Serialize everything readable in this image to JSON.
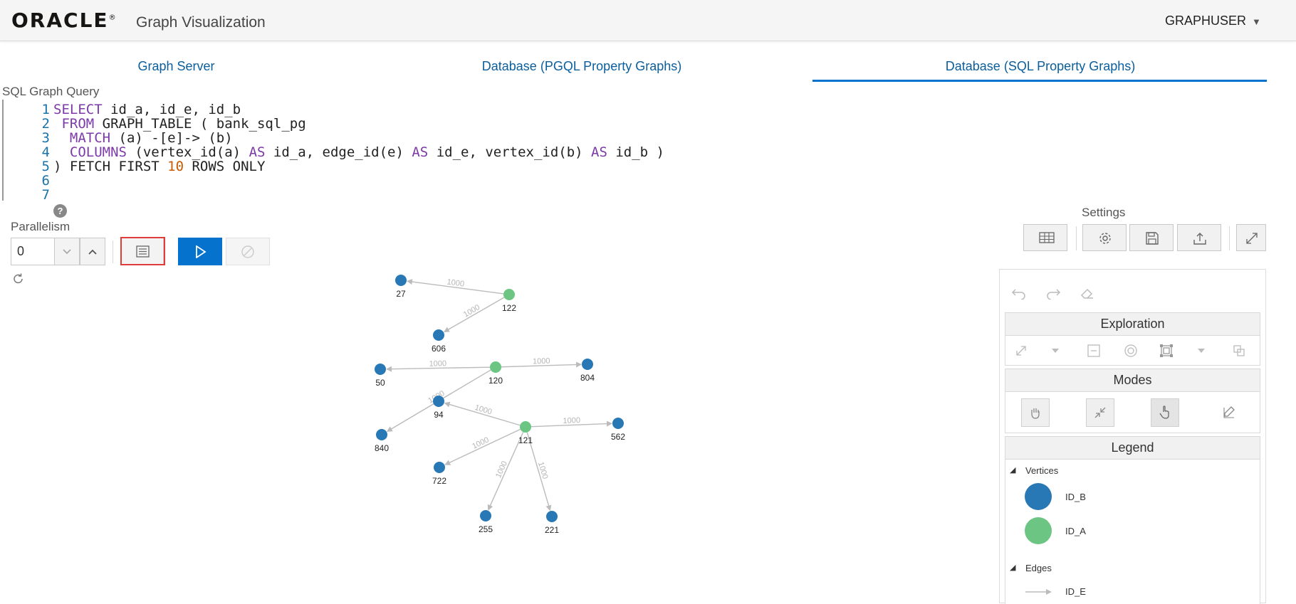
{
  "header": {
    "logo": "ORACLE",
    "logo_mark": "®",
    "app_title": "Graph Visualization",
    "user": "GRAPHUSER"
  },
  "tabs": [
    {
      "label": "Graph Server"
    },
    {
      "label": "Database (PGQL Property Graphs)"
    },
    {
      "label": "Database (SQL Property Graphs)",
      "active": true
    }
  ],
  "editor": {
    "label": "SQL Graph Query",
    "lines": [
      {
        "num": "1",
        "text": "SELECT id_a, id_e, id_b"
      },
      {
        "num": "2",
        "text": " FROM GRAPH_TABLE ( bank_sql_pg"
      },
      {
        "num": "3",
        "text": "  MATCH (a) -[e]-> (b)"
      },
      {
        "num": "4",
        "text": "  COLUMNS (vertex_id(a) AS id_a, edge_id(e) AS id_e, vertex_id(b) AS id_b )"
      },
      {
        "num": "5",
        "text": ") FETCH FIRST 10 ROWS ONLY"
      },
      {
        "num": "6",
        "text": ""
      },
      {
        "num": "7",
        "text": ""
      }
    ]
  },
  "query_controls": {
    "help": "?",
    "parallelism_label": "Parallelism",
    "parallelism_value": "0"
  },
  "settings": {
    "label": "Settings"
  },
  "panel": {
    "exploration": "Exploration",
    "modes": "Modes",
    "legend": "Legend",
    "vertices_label": "Vertices",
    "edges_label": "Edges",
    "vertex_items": [
      {
        "label": "ID_B",
        "color": "#2878b5"
      },
      {
        "label": "ID_A",
        "color": "#6cc582"
      }
    ],
    "edge_items": [
      {
        "label": "ID_E",
        "color": "#bbbbbb"
      }
    ]
  },
  "graph": {
    "colors": {
      "id_b": "#2878b5",
      "id_a": "#6cc582",
      "edge": "#bbbbbb"
    },
    "nodes": [
      {
        "id": "27",
        "type": "id_b"
      },
      {
        "id": "122",
        "type": "id_a"
      },
      {
        "id": "606",
        "type": "id_b"
      },
      {
        "id": "50",
        "type": "id_b"
      },
      {
        "id": "120",
        "type": "id_a"
      },
      {
        "id": "804",
        "type": "id_b"
      },
      {
        "id": "94",
        "type": "id_b"
      },
      {
        "id": "840",
        "type": "id_b"
      },
      {
        "id": "121",
        "type": "id_a"
      },
      {
        "id": "562",
        "type": "id_b"
      },
      {
        "id": "722",
        "type": "id_b"
      },
      {
        "id": "255",
        "type": "id_b"
      },
      {
        "id": "221",
        "type": "id_b"
      }
    ],
    "edges": [
      {
        "from": "122",
        "to": "27",
        "label": "1000"
      },
      {
        "from": "122",
        "to": "606",
        "label": "1000"
      },
      {
        "from": "120",
        "to": "50",
        "label": "1000"
      },
      {
        "from": "120",
        "to": "804",
        "label": "1000"
      },
      {
        "from": "120",
        "to": "840",
        "label": "1000"
      },
      {
        "from": "121",
        "to": "94",
        "label": "1000"
      },
      {
        "from": "121",
        "to": "562",
        "label": "1000"
      },
      {
        "from": "121",
        "to": "722",
        "label": "1000"
      },
      {
        "from": "121",
        "to": "255",
        "label": "1000"
      },
      {
        "from": "121",
        "to": "221",
        "label": "1000"
      }
    ]
  }
}
